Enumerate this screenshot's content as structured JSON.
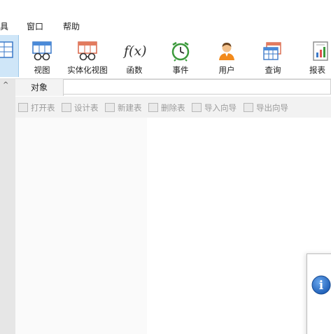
{
  "menubar": {
    "items": [
      {
        "label": "具",
        "name": "menu-tools"
      },
      {
        "label": "窗口",
        "name": "menu-window"
      },
      {
        "label": "帮助",
        "name": "menu-help"
      }
    ]
  },
  "toolbar": {
    "buttons": [
      {
        "label": "视图",
        "icon": "view-icon"
      },
      {
        "label": "实体化视图",
        "icon": "materialized-view-icon"
      },
      {
        "label": "函数",
        "icon": "function-icon"
      },
      {
        "label": "事件",
        "icon": "event-clock-icon"
      },
      {
        "label": "用户",
        "icon": "user-icon"
      },
      {
        "label": "查询",
        "icon": "query-icon"
      },
      {
        "label": "报表",
        "icon": "report-icon"
      }
    ],
    "function_glyph": "f(x)"
  },
  "tabs": {
    "object_label": "对象",
    "scroll_up_glyph": "^"
  },
  "actions": [
    {
      "label": "打开表"
    },
    {
      "label": "设计表"
    },
    {
      "label": "新建表"
    },
    {
      "label": "删除表"
    },
    {
      "label": "导入向导"
    },
    {
      "label": "导出向导"
    }
  ],
  "dialog": {
    "icon": "info-icon",
    "icon_glyph": "i"
  },
  "colors": {
    "active_tool": "#cfe6f8",
    "actions_bg": "#f2f2f2",
    "info_blue": "#1f5fb7"
  }
}
